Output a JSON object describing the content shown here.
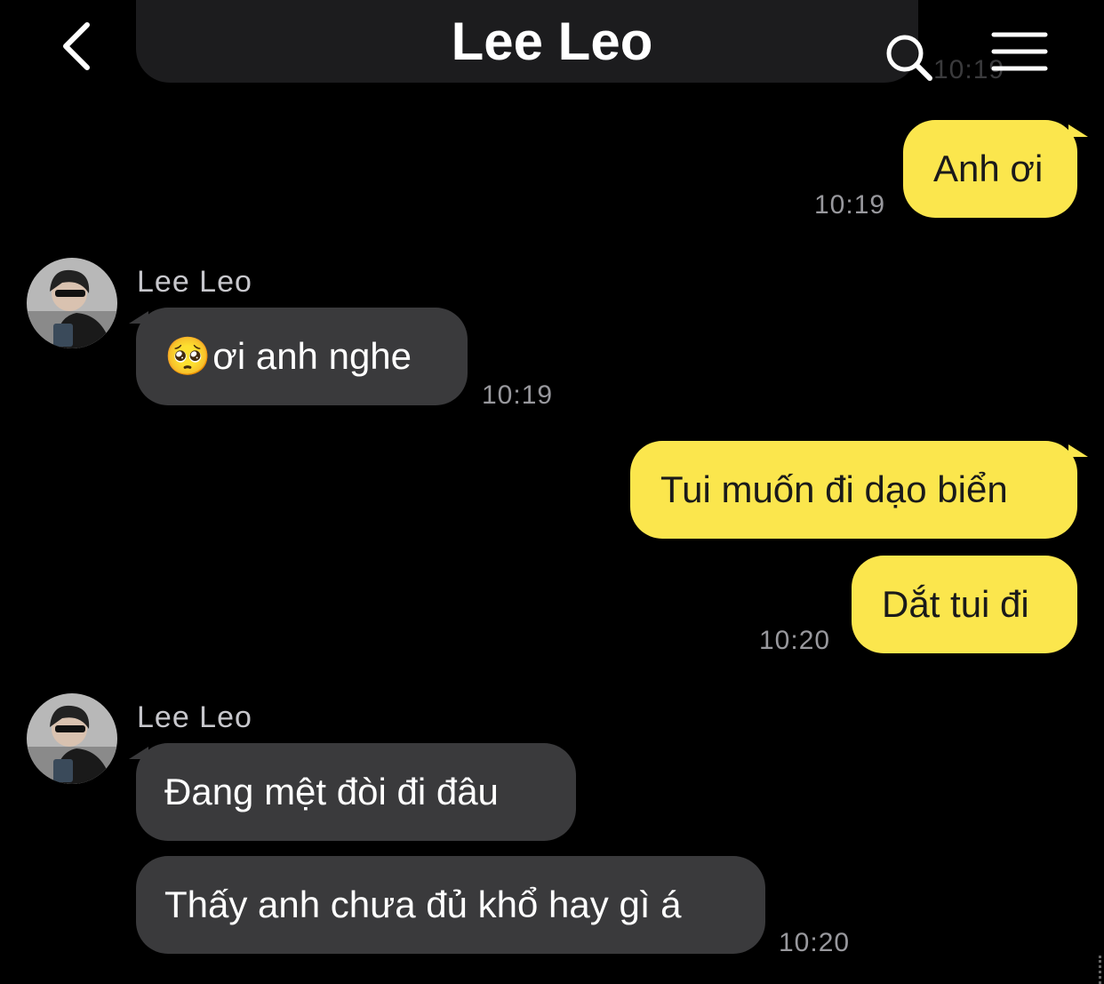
{
  "header": {
    "title": "Lee Leo",
    "back_icon": "chevron-left-icon",
    "search_icon": "search-icon",
    "menu_icon": "hamburger-menu-icon"
  },
  "previous_message": {
    "time": "10:19"
  },
  "messages": [
    {
      "direction": "out",
      "text": "Anh ơi",
      "time": "10:19"
    },
    {
      "direction": "in",
      "sender": "Lee Leo",
      "emoji": "🥺",
      "text": "ơi anh nghe",
      "time": "10:19"
    },
    {
      "direction": "out",
      "text": "Tui muốn đi dạo biển"
    },
    {
      "direction": "out",
      "text": "Dắt tui đi",
      "time": "10:20"
    },
    {
      "direction": "in",
      "sender": "Lee Leo",
      "text": "Đang mệt đòi đi đâu"
    },
    {
      "direction": "in",
      "text": "Thấy anh chưa đủ khổ hay gì á",
      "time": "10:20"
    }
  ],
  "colors": {
    "background": "#000000",
    "outgoing_bubble": "#fbe64d",
    "incoming_bubble": "#3a3a3c",
    "timestamp": "#98989d"
  }
}
